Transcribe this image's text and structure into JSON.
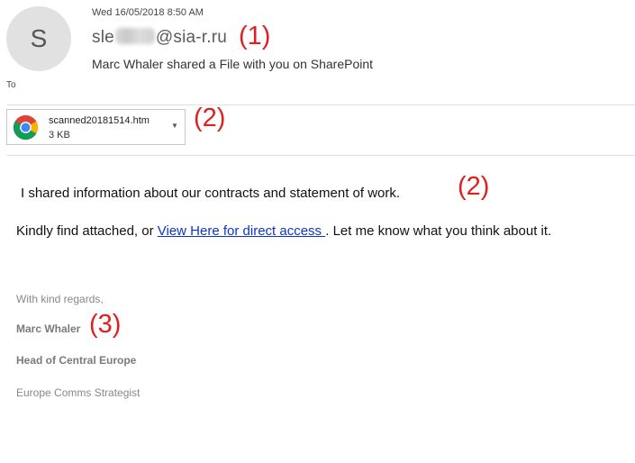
{
  "header": {
    "avatar_initial": "S",
    "date": "Wed 16/05/2018 8:50 AM",
    "sender_prefix": "sle",
    "sender_domain": "@sia-r.ru",
    "subject": "Marc Whaler shared a File with you on SharePoint",
    "to_label": "To"
  },
  "annotations": {
    "marker_1": "(1)",
    "marker_2_attachment": "(2)",
    "marker_2_body": "(2)",
    "marker_3": "(3)",
    "color": "#e02020"
  },
  "attachment": {
    "icon": "chrome-icon",
    "filename": "scanned20181514.htm",
    "size": "3 KB",
    "dropdown_icon": "chevron-down-icon"
  },
  "body": {
    "line1": "I shared information about our contracts and statement of work.",
    "line2_before": "Kindly find attached, or ",
    "line2_link": "View Here for direct access ",
    "line2_after": ". Let me know what you think about it.",
    "link_color": "#0b34d8"
  },
  "signature": {
    "regards": "With kind regards,",
    "name": "Marc Whaler",
    "title": "Head of Central Europe",
    "role": "Europe Comms Strategist"
  }
}
